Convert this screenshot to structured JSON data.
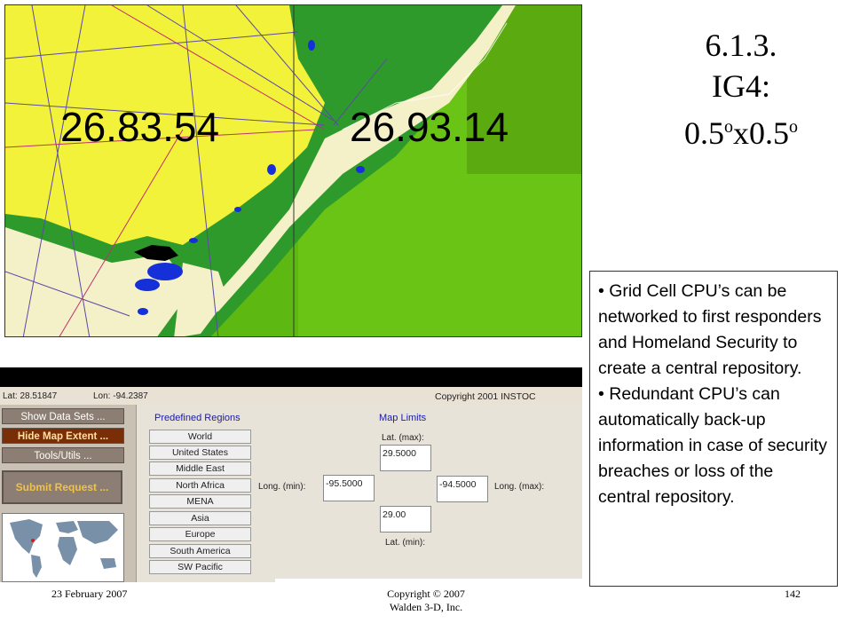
{
  "map": {
    "cell_left_label": "26.83.54",
    "cell_right_label": "26.93.14"
  },
  "slide": {
    "title_line1": "6.1.3.",
    "title_line2": "IG4:",
    "title_line3_a": "0.5",
    "title_line3_deg1": "o",
    "title_line3_b": "x0.5",
    "title_line3_deg2": "o"
  },
  "status_bar": {
    "lat": "Lat: 28.51847",
    "lon": "Lon: -94.2387",
    "copyright": "Copyright 2001  INSTOC"
  },
  "sidebar": {
    "show_data_sets": "Show Data Sets ...",
    "hide_map_extent": "Hide Map Extent ...",
    "tools_utils": "Tools/Utils ...",
    "submit_request": "Submit Request ..."
  },
  "regions": {
    "heading": "Predefined Regions",
    "items": [
      "World",
      "United States",
      "Middle East",
      "North Africa",
      "MENA",
      "Asia",
      "Europe",
      "South America",
      "SW Pacific"
    ]
  },
  "map_limits": {
    "heading": "Map Limits",
    "lat_max_label": "Lat. (max):",
    "lat_max_value": "29.5000",
    "long_min_label": "Long. (min):",
    "long_min_value": "-95.5000",
    "long_max_label": "Long. (max):",
    "long_max_value": "-94.5000",
    "lat_min_label": "Lat. (min):",
    "lat_min_value": "29.00"
  },
  "textbox": {
    "para1": "• Grid Cell CPU’s can be networked to first responders and Homeland Security to create a central repository.",
    "para2": "• Redundant CPU’s can automatically back-up information in case of security breaches or loss of the central repository."
  },
  "footer": {
    "date": "23 February 2007",
    "copyright_line1": "Copyright © 2007",
    "copyright_line2": "Walden 3-D, Inc.",
    "page_number": "142"
  },
  "colors": {
    "land_yellow": "#f2f23a",
    "sea_green": "#6cc214",
    "dark_green": "#2f9a2c",
    "sand": "#f4f0c8",
    "water_blue": "#1530d8"
  }
}
